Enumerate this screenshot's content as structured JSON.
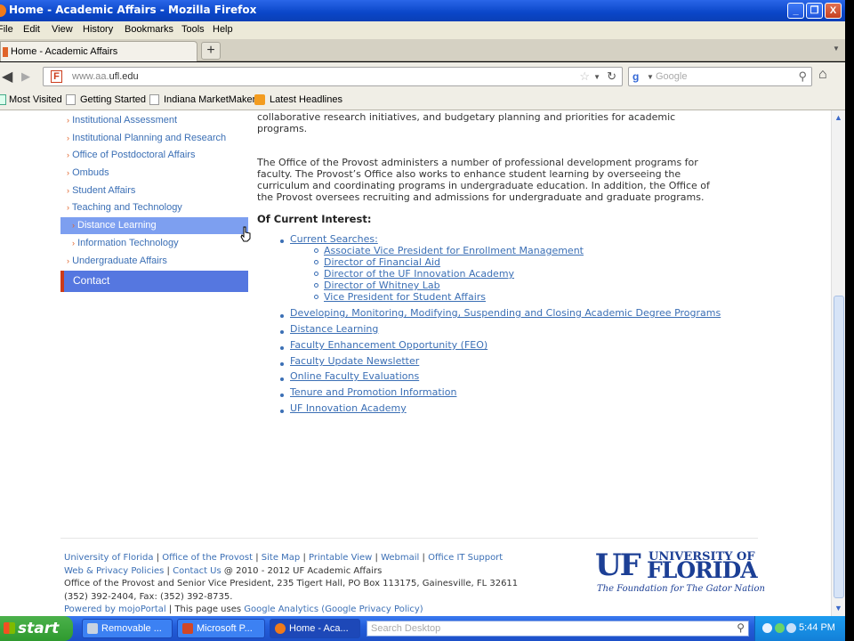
{
  "window": {
    "title": "Home - Academic Affairs - Mozilla Firefox",
    "min_label": "_",
    "max_label": "❐",
    "close_label": "X"
  },
  "menu": {
    "file": "File",
    "edit": "Edit",
    "view": "View",
    "history": "History",
    "bookmarks": "Bookmarks",
    "tools": "Tools",
    "help": "Help"
  },
  "tab": {
    "title": "Home - Academic Affairs",
    "new_tab": "+"
  },
  "nav": {
    "url_dim": "www.aa.",
    "url_main": "ufl.edu",
    "search_placeholder": "Google"
  },
  "bookmarks": [
    "Most Visited",
    "Getting Started",
    "Indiana MarketMaker",
    "Latest Headlines"
  ],
  "sidebar": {
    "items": [
      "Institutional Assessment",
      "Institutional Planning and Research",
      "Office of Postdoctoral Affairs",
      "Ombuds",
      "Student Affairs",
      "Teaching and Technology"
    ],
    "active_item": "Distance Learning",
    "subitem": "Information Technology",
    "after_item": "Undergraduate Affairs",
    "contact": "Contact"
  },
  "main": {
    "para1_line1": "collaborative research initiatives, and budgetary planning and priorities for academic",
    "para1_line2": "programs.",
    "para2_line1": "The Office of the Provost administers a number of professional development programs for",
    "para2_line2": "faculty. The Provost’s Office also works to enhance student learning by overseeing the",
    "para2_line3": "curriculum and coordinating programs in undergraduate education.  In addition, the Office of",
    "para2_line4": "the Provost oversees recruiting and admissions for undergraduate and graduate programs.",
    "interest_heading": "Of Current Interest:",
    "current_searches": "Current Searches:",
    "searches": [
      "Associate Vice President for Enrollment Management",
      "Director of Financial Aid",
      "Director of the UF Innovation Academy",
      "Director of Whitney Lab",
      "Vice President for Student Affairs"
    ],
    "links": [
      "Developing, Monitoring, Modifying, Suspending and Closing Academic Degree Programs",
      "Distance Learning",
      "Faculty Enhancement Opportunity (FEO)",
      "Faculty Update Newsletter",
      "Online Faculty Evaluations",
      "Tenure and Promotion Information",
      "UF Innovation Academy"
    ]
  },
  "footer": {
    "links1": [
      "University of Florida",
      "Office of the Provost",
      "Site Map",
      "Printable View",
      "Webmail",
      "Office IT Support"
    ],
    "web_privacy": "Web & Privacy Policies",
    "contact_us": "Contact Us",
    "copyright": "@ 2010 - 2012 UF Academic Affairs",
    "address": "Office of the Provost and Senior Vice President, 235 Tigert Hall, PO Box 113175, Gainesville, FL 32611",
    "phone": "(352) 392-2404, Fax: (352) 392-8735.",
    "powered_by": "Powered by",
    "mojoportal": "mojoPortal",
    "uses": " | This page uses ",
    "analytics": "Google Analytics",
    "privacy": "(Google Privacy Policy)",
    "sep": "|"
  },
  "logo": {
    "uf": "UF",
    "university": "UNIVERSITY OF",
    "florida": "FLORIDA",
    "tagline": "The Foundation for The Gator Nation"
  },
  "taskbar": {
    "start": "start",
    "tasks": [
      "Removable ...",
      "Microsoft P...",
      "Home - Aca..."
    ],
    "search_placeholder": "Search Desktop",
    "clock": "5:44 PM"
  },
  "colors": {
    "link": "#3b6fb5",
    "sidebar_active": "#7d9ff0",
    "contact": "#5577e0",
    "uf_blue": "#1c3f95",
    "uf_orange": "#e0642a"
  }
}
